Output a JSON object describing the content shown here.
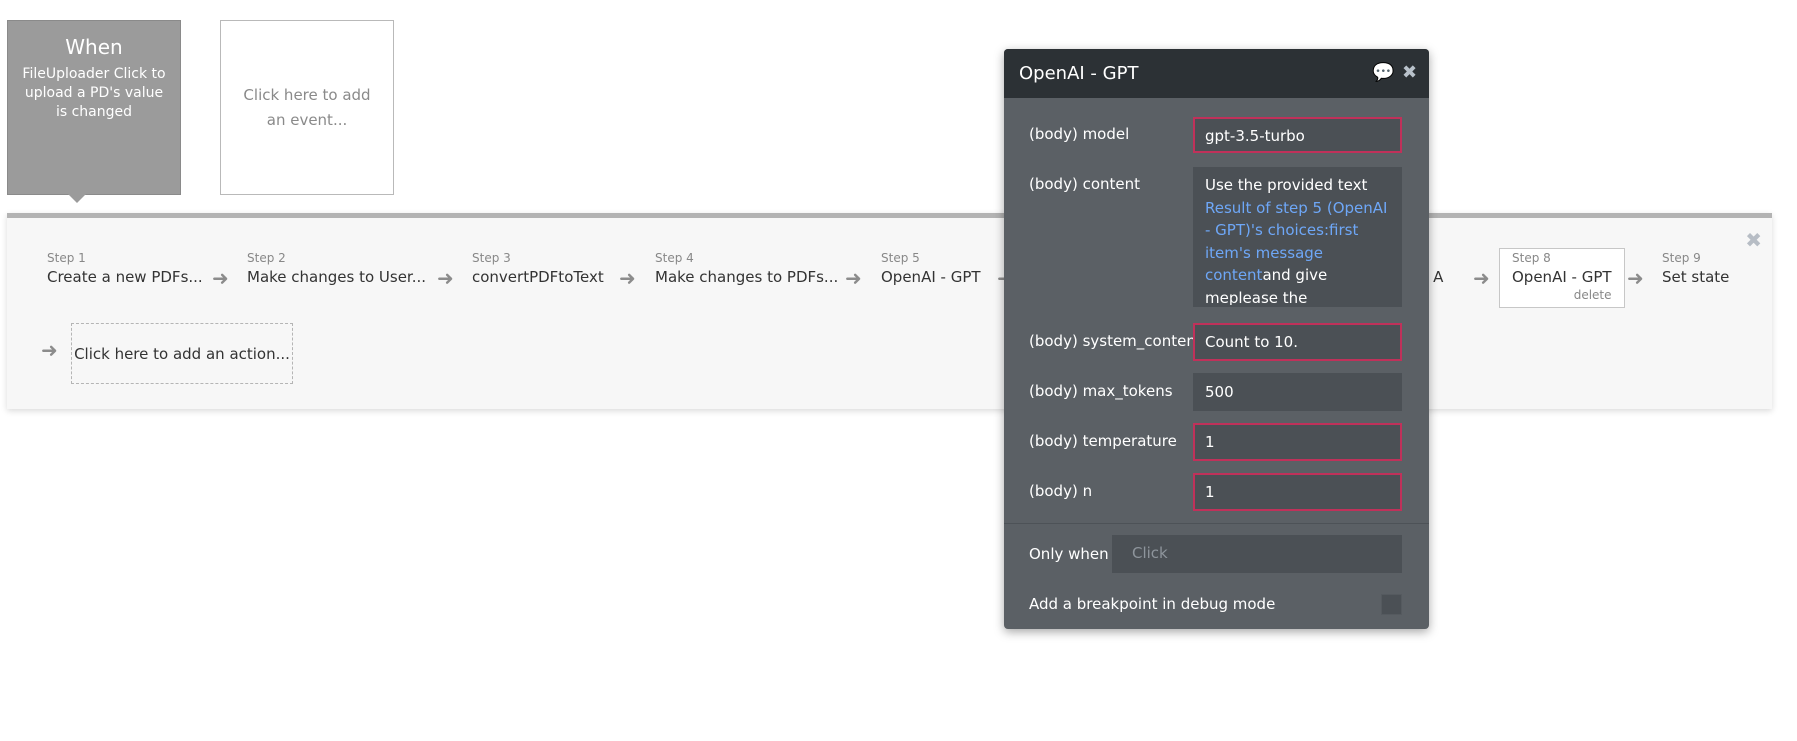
{
  "events": {
    "when_title": "When",
    "when_desc": "FileUploader Click to upload a PD's value is changed",
    "add_event": "Click here to add an event..."
  },
  "steps": [
    {
      "num": "Step 1",
      "name": "Create a new PDFs..."
    },
    {
      "num": "Step 2",
      "name": "Make changes to User..."
    },
    {
      "num": "Step 3",
      "name": "convertPDFtoText"
    },
    {
      "num": "Step 4",
      "name": "Make changes to PDFs..."
    },
    {
      "num": "Step 5",
      "name": "OpenAI - GPT"
    },
    {
      "num": "",
      "name": "er A"
    },
    {
      "num": "Step 8",
      "name": "OpenAI - GPT",
      "extra": "delete"
    },
    {
      "num": "Step 9",
      "name": "Set state"
    }
  ],
  "add_action": "Click here to add an action...",
  "dialog": {
    "title": "OpenAI - GPT",
    "rows": {
      "model": {
        "label": "(body) model",
        "value": "gpt-3.5-turbo"
      },
      "content": {
        "label": "(body) content",
        "text_before": "Use the provided text ",
        "dynamic": "Result of step 5 (OpenAI - GPT)'s choices:first item's message content",
        "text_after": "and give meplease the workbooks listed in the text."
      },
      "system": {
        "label": "(body) system_conten",
        "value": "Count  to 10."
      },
      "max_tokens": {
        "label": "(body) max_tokens",
        "value": "500"
      },
      "temperature": {
        "label": "(body) temperature",
        "value": "1"
      },
      "n": {
        "label": "(body) n",
        "value": "1"
      }
    },
    "only_when_label": "Only when",
    "only_when_placeholder": "Click",
    "breakpoint_label": "Add a breakpoint in debug mode"
  },
  "icons": {
    "comment": "💬",
    "close": "✖",
    "arrow": "➜"
  },
  "colors": {
    "dialog_bg": "#5b6065",
    "header_bg": "#2c3135",
    "error_border": "#c0315a",
    "dynamic_text": "#6ea7f7"
  }
}
